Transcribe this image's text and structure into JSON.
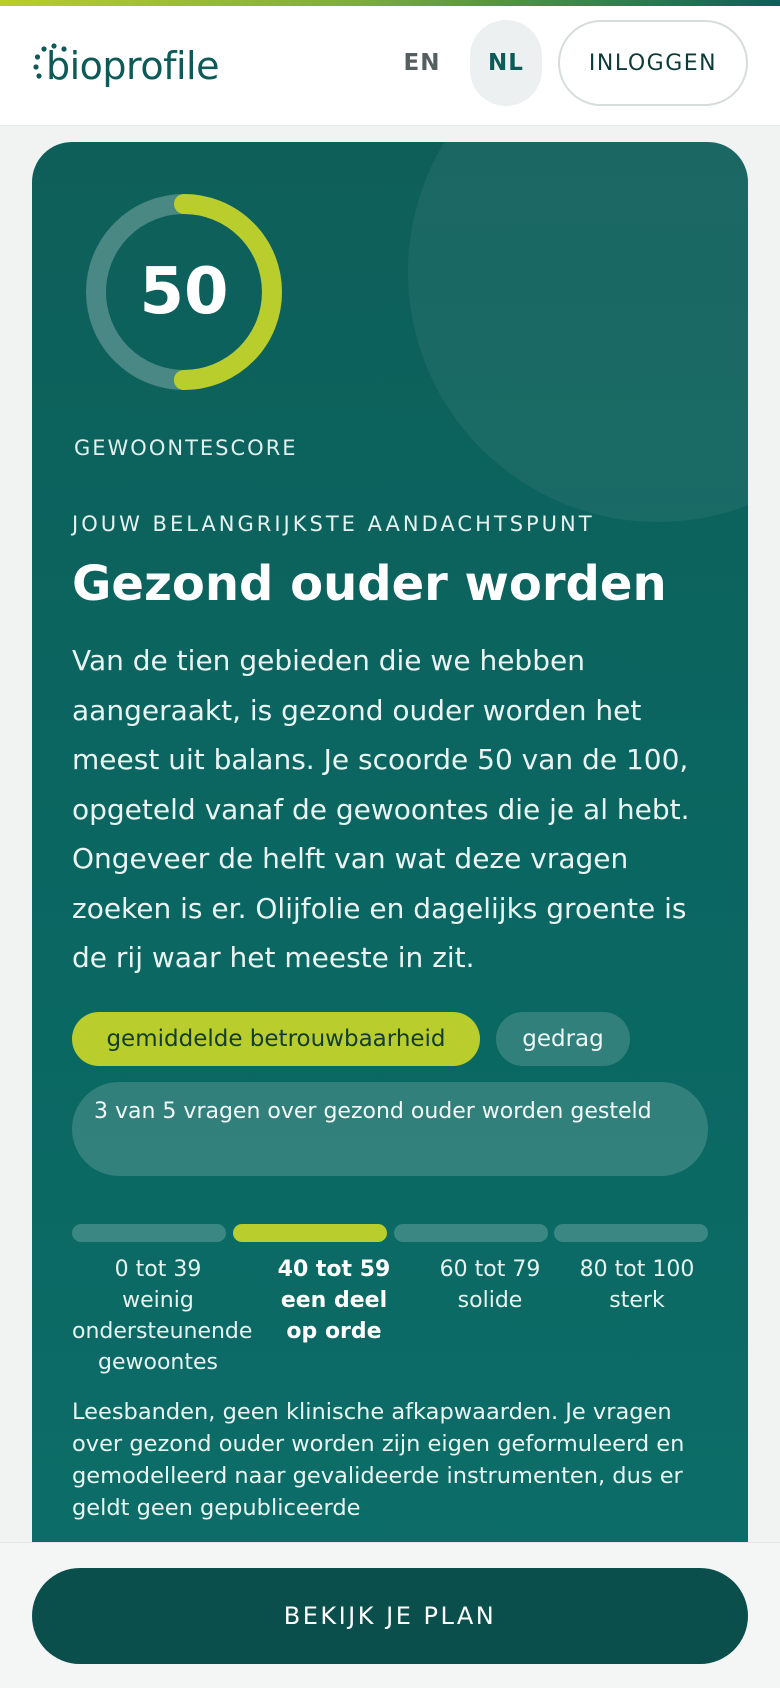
{
  "header": {
    "logo_text": "bioprofile",
    "lang_en": "EN",
    "lang_nl": "NL",
    "active_lang": "NL",
    "login_label": "INLOGGEN"
  },
  "score": {
    "value": "50",
    "max": 100,
    "label": "GEWOONTESCORE"
  },
  "focus": {
    "eyebrow": "JOUW BELANGRIJKSTE AANDACHTSPUNT",
    "title": "Gezond ouder worden",
    "description": "Van de tien gebieden die we hebben aangeraakt, is gezond ouder worden het meest uit balans. Je scoorde 50 van de 100, opgeteld vanaf de gewoontes die je al hebt. Ongeveer de helft van wat deze vragen zoeken is er. Olijfolie en dagelijks groente is de rij waar het meeste in zit."
  },
  "tags": {
    "reliability": "gemiddelde betrouwbaarheid",
    "type": "gedrag",
    "questions": "3 van 5 vragen over gezond ouder worden gesteld"
  },
  "bands": [
    {
      "range": "0 tot 39",
      "label": "weinig ondersteunende gewoontes",
      "active": false
    },
    {
      "range": "40 tot 59",
      "label": "een deel op orde",
      "active": true
    },
    {
      "range": "60 tot 79",
      "label": "solide",
      "active": false
    },
    {
      "range": "80 tot 100",
      "label": "sterk",
      "active": false
    }
  ],
  "footnote": "Leesbanden, geen klinische afkapwaarden. Je vragen over gezond ouder worden zijn eigen geformuleerd en gemodelleerd naar gevalideerde instrumenten, dus er geldt geen gepubliceerde",
  "cta_label": "BEKIJK JE PLAN",
  "colors": {
    "accent": "#b9cd2c",
    "card": "#0a6762",
    "cta": "#0b4f4d",
    "brand_text": "#0d5a57"
  }
}
